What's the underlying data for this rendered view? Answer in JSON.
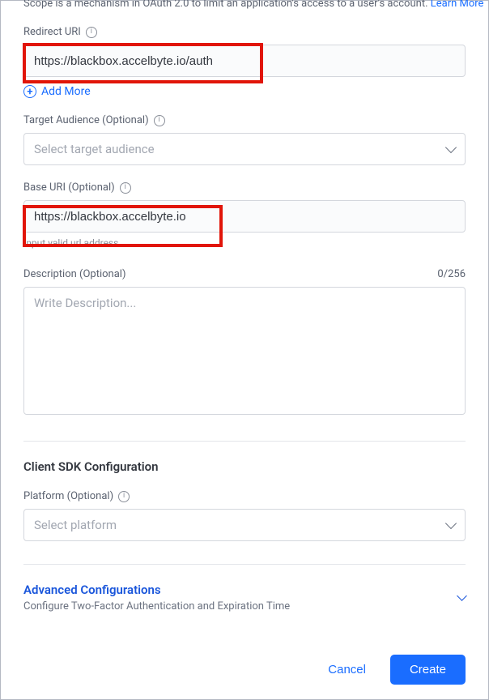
{
  "scope_text": "Scope is a mechanism in OAuth 2.0 to limit an application's access to a user's account.",
  "scope_link": "Learn More",
  "redirect": {
    "label": "Redirect URI",
    "value": "https://blackbox.accelbyte.io/auth",
    "add_more": "Add More"
  },
  "target": {
    "label": "Target Audience (Optional)",
    "placeholder": "Select target audience"
  },
  "base": {
    "label": "Base URI (Optional)",
    "value": "https://blackbox.accelbyte.io",
    "hint": "Input valid url address"
  },
  "description": {
    "label": "Description (Optional)",
    "counter": "0/256",
    "placeholder": "Write Description..."
  },
  "sdk": {
    "title": "Client SDK Configuration",
    "platform_label": "Platform (Optional)",
    "platform_placeholder": "Select platform"
  },
  "advanced": {
    "title": "Advanced Configurations",
    "subtitle": "Configure Two-Factor Authentication and Expiration Time"
  },
  "buttons": {
    "cancel": "Cancel",
    "create": "Create"
  }
}
